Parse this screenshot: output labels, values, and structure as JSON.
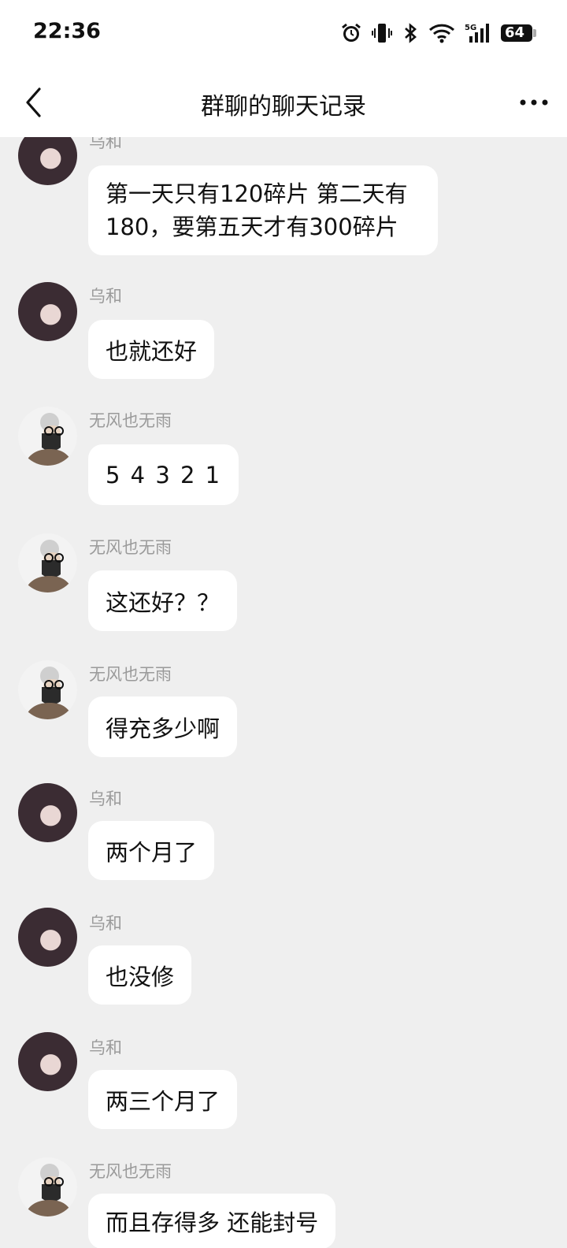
{
  "status_bar": {
    "time": "22:36",
    "battery": "64",
    "icons": [
      "alarm-icon",
      "vibrate-icon",
      "bluetooth-icon",
      "wifi-icon",
      "signal-5g-icon",
      "battery-icon"
    ]
  },
  "header": {
    "title": "群聊的聊天记录",
    "back_icon": "chevron-left-icon",
    "more_icon": "more-horizontal-icon"
  },
  "messages": [
    {
      "sender": "乌和",
      "text": "第一天只有120碎片 第二天有180，要第五天才有300碎片",
      "avatar": "female"
    },
    {
      "sender": "乌和",
      "text": "也就还好",
      "avatar": "female"
    },
    {
      "sender": "无风也无雨",
      "text": "5 4 3 2 1",
      "avatar": "male"
    },
    {
      "sender": "无风也无雨",
      "text": "这还好？？",
      "avatar": "male"
    },
    {
      "sender": "无风也无雨",
      "text": "得充多少啊",
      "avatar": "male"
    },
    {
      "sender": "乌和",
      "text": "两个月了",
      "avatar": "female"
    },
    {
      "sender": "乌和",
      "text": "也没修",
      "avatar": "female"
    },
    {
      "sender": "乌和",
      "text": "两三个月了",
      "avatar": "female"
    },
    {
      "sender": "无风也无雨",
      "text": "而且存得多 还能封号",
      "avatar": "male"
    }
  ],
  "colors": {
    "background": "#efefef",
    "bubble": "#ffffff",
    "sender_name": "#9a9a9a"
  }
}
